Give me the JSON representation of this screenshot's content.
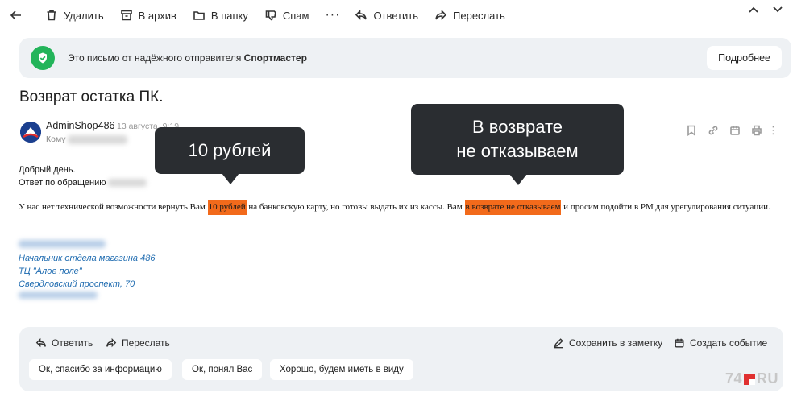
{
  "toolbar": {
    "delete": "Удалить",
    "archive": "В архив",
    "folder": "В папку",
    "spam": "Спам",
    "more": "···",
    "reply": "Ответить",
    "forward": "Переслать"
  },
  "trusted_banner": {
    "text": "Это письмо от надёжного отправителя ",
    "sender": "Спортмастер",
    "details_button": "Подробнее"
  },
  "subject": "Возврат остатка ПК.",
  "sender": {
    "name": "AdminShop486",
    "date": "13 августа, 9:19",
    "to_label": "Кому"
  },
  "body": {
    "greeting": "Добрый день.",
    "reference": "Ответ по обращению",
    "line_part1": "У нас нет технической возможности вернуть Вам ",
    "highlight1": "10 рублей",
    "line_part2": " на банковскую карту, но готовы выдать их из кассы. Вам ",
    "highlight2": "в возврате не отказываем",
    "line_part3": " и просим подойти в РМ для урегулирования ситуации."
  },
  "signature": {
    "line1": "Начальник отдела магазина 486",
    "line2": "ТЦ \"Алое поле\"",
    "line3": "Свердловский проспект, 70"
  },
  "callouts": {
    "left": "10 рублей",
    "right_line1": "В возврате",
    "right_line2": "не отказываем"
  },
  "reply_panel": {
    "reply": "Ответить",
    "forward": "Переслать",
    "save_note": "Сохранить в заметку",
    "create_event": "Создать событие",
    "quick_replies": [
      "Ок, спасибо за информацию",
      "Ок, понял Вас",
      "Хорошо, будем иметь в виду"
    ]
  },
  "watermark": {
    "left": "74",
    "right": "RU"
  },
  "colors": {
    "highlight": "#f26a1b",
    "trusted_green": "#23b45a",
    "signature_blue": "#1e6bb0",
    "callout_bg": "#2a2d31"
  }
}
